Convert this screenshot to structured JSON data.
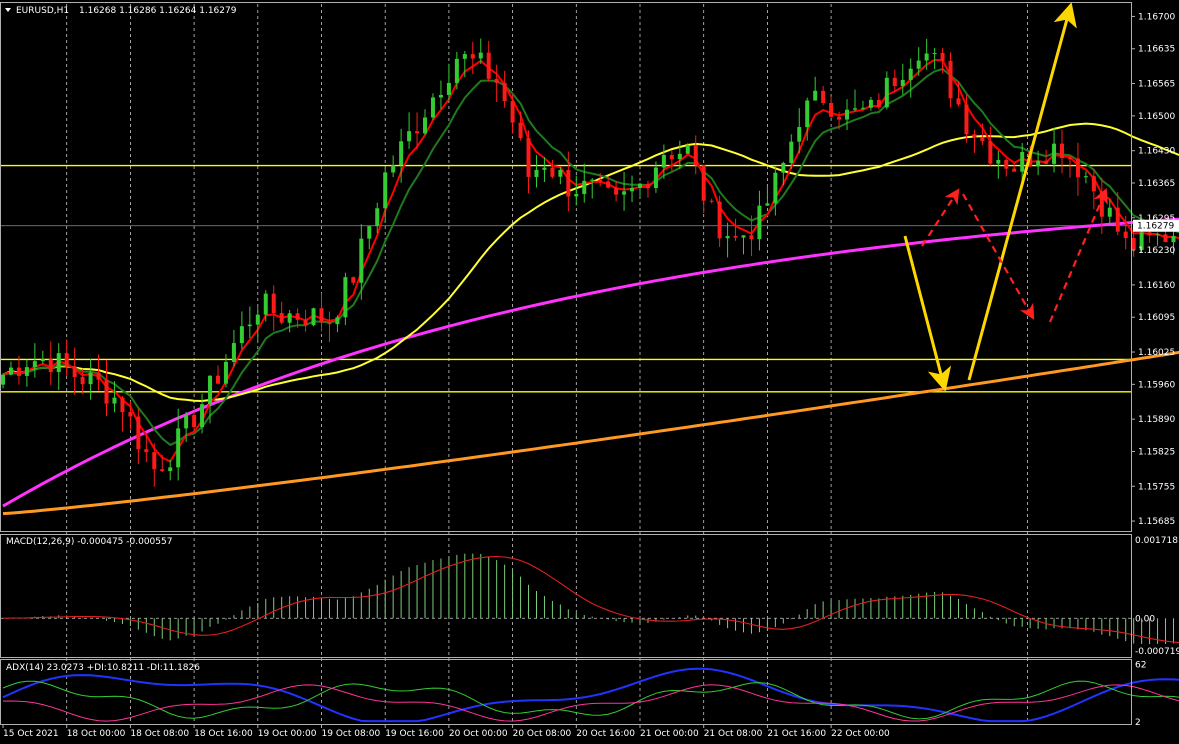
{
  "chart_data": {
    "type": "candlestick",
    "symbol_header": "EURUSD,H1",
    "ohlc_header": "1.16268 1.16286 1.16264 1.16279",
    "price_ylim": [
      1.15665,
      1.16725
    ],
    "price_ticks": [
      "1.16700",
      "1.16635",
      "1.16565",
      "1.16500",
      "1.16430",
      "1.16365",
      "1.16295",
      "1.16230",
      "1.16160",
      "1.16095",
      "1.16025",
      "1.15960",
      "1.15890",
      "1.15825",
      "1.15755",
      "1.15685"
    ],
    "current_price": "1.16279",
    "time_labels": [
      "15 Oct 2021",
      "18 Oct 00:00",
      "18 Oct 08:00",
      "18 Oct 16:00",
      "19 Oct 00:00",
      "19 Oct 08:00",
      "19 Oct 16:00",
      "20 Oct 00:00",
      "20 Oct 08:00",
      "20 Oct 16:00",
      "21 Oct 00:00",
      "21 Oct 08:00",
      "21 Oct 16:00",
      "22 Oct 00:00"
    ],
    "horizontal_levels": [
      1.164,
      1.1601,
      1.15945
    ],
    "candles": [],
    "indicators": {
      "ema_fast_color": "#ff0000",
      "ema_slow_color": "#1f7a1f",
      "ma_50_color": "#ffff33",
      "ma_100_color": "#ff33ff",
      "ma_200_color": "#ff9922"
    },
    "macd": {
      "header": "MACD(12,26,9) -0.000475 -0.000557",
      "ticks": [
        "0.001718",
        "0.00",
        "-0.000719"
      ],
      "ylim": [
        -0.00085,
        0.00185
      ]
    },
    "adx": {
      "header": "ADX(14) 23.0273 +DI:10.8211 -DI:11.1826",
      "ticks": [
        "62",
        "2"
      ],
      "ylim": [
        0,
        68
      ]
    },
    "annotation_arrows": [
      {
        "style": "solid",
        "color": "#ffd700",
        "from": [
          1.1628,
          "22 Oct 04:00"
        ],
        "to": [
          1.1598,
          "22 Oct 08:00"
        ]
      },
      {
        "style": "solid",
        "color": "#ffd700",
        "from": [
          1.1598,
          "22 Oct 08:00"
        ],
        "to": [
          1.1672,
          "22 Oct 22:00"
        ]
      },
      {
        "style": "dashed",
        "color": "#ff2020",
        "from": [
          1.1626,
          "22 Oct 05:00"
        ],
        "to": [
          1.1638,
          "22 Oct 10:00"
        ]
      },
      {
        "style": "dashed",
        "color": "#ff2020",
        "from": [
          1.1638,
          "22 Oct 10:00"
        ],
        "to": [
          1.1611,
          "22 Oct 16:00"
        ]
      },
      {
        "style": "dashed",
        "color": "#ff2020",
        "from": [
          1.161,
          "22 Oct 17:00"
        ],
        "to": [
          1.1637,
          "22 Oct 23:00"
        ]
      }
    ]
  }
}
